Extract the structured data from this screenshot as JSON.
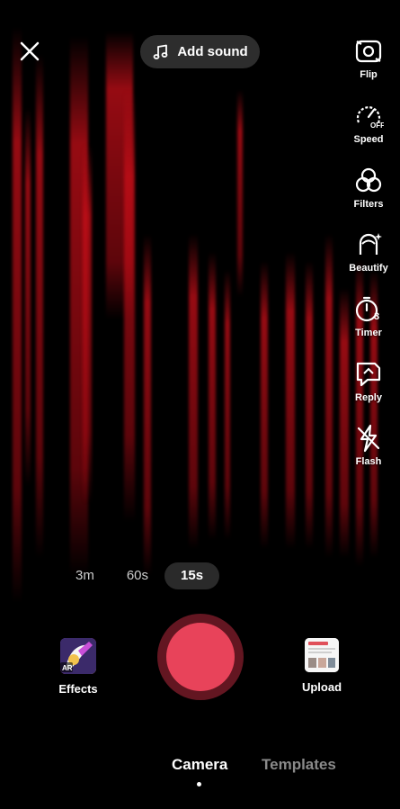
{
  "top": {
    "add_sound_label": "Add sound"
  },
  "tools": [
    {
      "label": "Flip",
      "icon": "flip-icon"
    },
    {
      "label": "Speed",
      "icon": "speed-icon",
      "badge": "OFF"
    },
    {
      "label": "Filters",
      "icon": "filters-icon"
    },
    {
      "label": "Beautify",
      "icon": "beautify-icon"
    },
    {
      "label": "Timer",
      "icon": "timer-icon",
      "badge": "3"
    },
    {
      "label": "Reply",
      "icon": "reply-icon"
    },
    {
      "label": "Flash",
      "icon": "flash-icon"
    }
  ],
  "durations": [
    {
      "label": "3m",
      "active": false
    },
    {
      "label": "60s",
      "active": false
    },
    {
      "label": "15s",
      "active": true
    }
  ],
  "effects": {
    "label": "Effects",
    "badge": "AR"
  },
  "upload": {
    "label": "Upload"
  },
  "tabs": {
    "camera": "Camera",
    "templates": "Templates"
  },
  "colors": {
    "record": "#e8435a",
    "accent_red": "#c8101a"
  }
}
